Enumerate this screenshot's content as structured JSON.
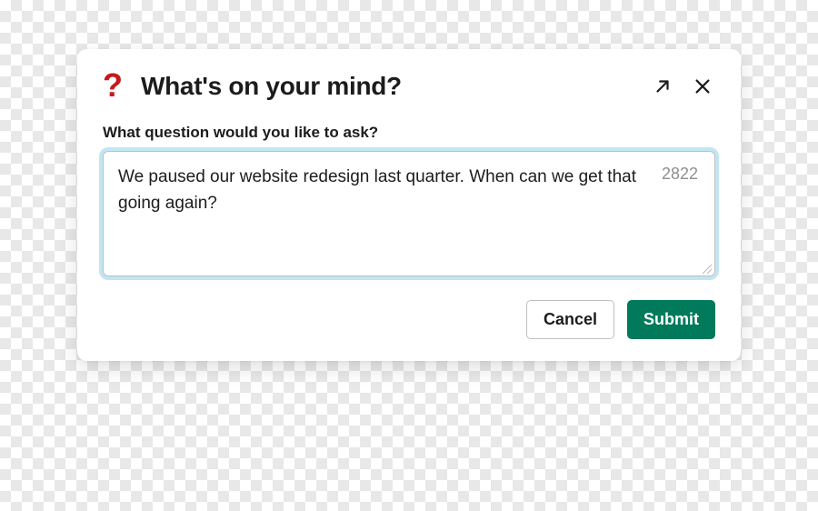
{
  "modal": {
    "title": "What's on your mind?",
    "field_label": "What question would you like to ask?",
    "textarea_value": "We paused our website redesign last quarter. When can we get that going again?",
    "char_counter": "2822",
    "footer": {
      "cancel_label": "Cancel",
      "submit_label": "Submit"
    }
  },
  "colors": {
    "accent_icon": "#c61a1a",
    "submit_bg": "#007a5a",
    "focus_ring": "#c1e5f3"
  }
}
